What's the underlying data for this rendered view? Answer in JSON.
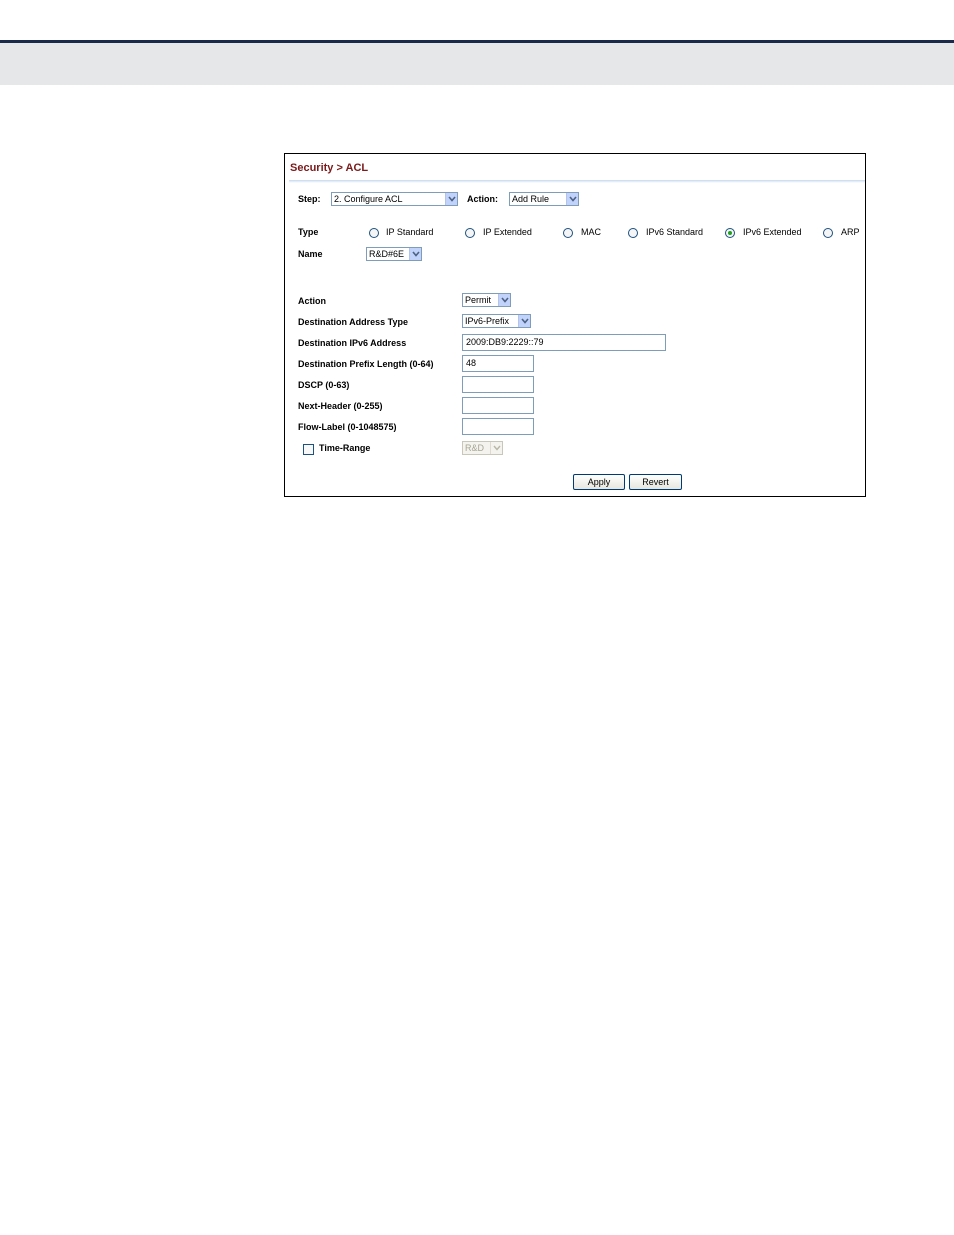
{
  "breadcrumb": "Security > ACL",
  "step": {
    "label": "Step:",
    "value": "2. Configure ACL"
  },
  "action_select": {
    "label": "Action:",
    "value": "Add Rule"
  },
  "type": {
    "label": "Type",
    "options": [
      "IP Standard",
      "IP Extended",
      "MAC",
      "IPv6 Standard",
      "IPv6 Extended",
      "ARP"
    ],
    "selected": "IPv6 Extended"
  },
  "name": {
    "label": "Name",
    "value": "R&D#6E"
  },
  "form": {
    "action": {
      "label": "Action",
      "value": "Permit"
    },
    "dest_address_type": {
      "label": "Destination Address Type",
      "value": "IPv6-Prefix"
    },
    "dest_ipv6_address": {
      "label": "Destination IPv6 Address",
      "value": "2009:DB9:2229::79"
    },
    "dest_prefix_length": {
      "label": "Destination Prefix Length (0-64)",
      "value": "48"
    },
    "dscp": {
      "label": "DSCP (0-63)",
      "value": ""
    },
    "next_header": {
      "label": "Next-Header (0-255)",
      "value": ""
    },
    "flow_label": {
      "label": "Flow-Label (0-1048575)",
      "value": ""
    },
    "time_range": {
      "label": "Time-Range",
      "checked": false,
      "value": "R&D"
    }
  },
  "buttons": {
    "apply": "Apply",
    "revert": "Revert"
  },
  "colors": {
    "breadcrumb": "#7a1a1a",
    "header_rule": "#1b2a4a",
    "header_band": "#e6e7e8"
  }
}
